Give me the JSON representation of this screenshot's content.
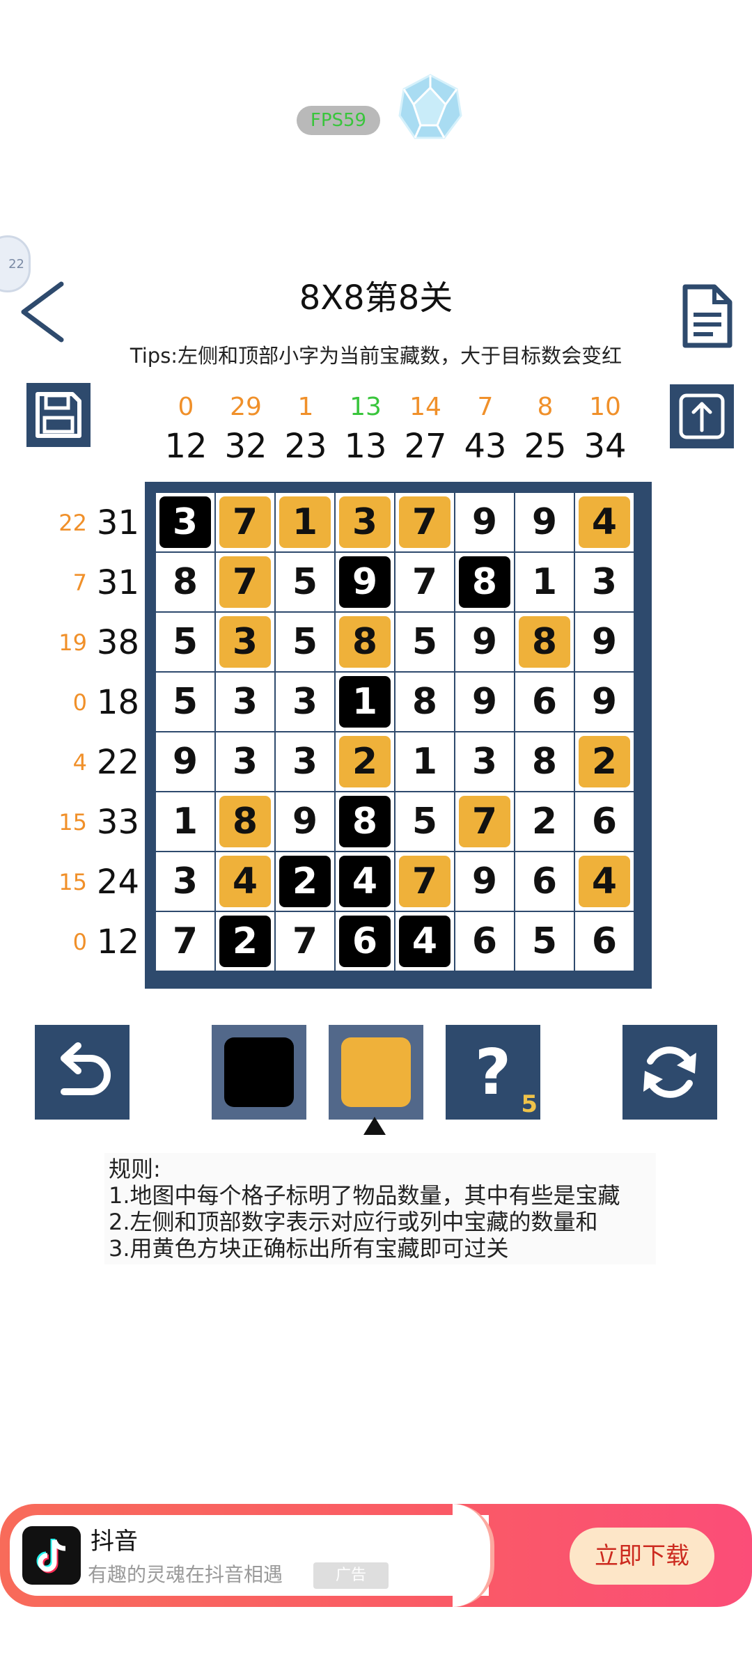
{
  "status": {
    "fps": "FPS59"
  },
  "header": {
    "title": "8X8第8关",
    "tips": "Tips:左侧和顶部小字为当前宝藏数，大于目标数会变红",
    "float_ball_text": "22"
  },
  "colors": {
    "board": "#2e4a6d",
    "treasure_yellow": "#efb13a",
    "black_mark": "#000000",
    "current_ok_green": "#39c53c",
    "current_orange": "#f0902a"
  },
  "columns": [
    {
      "current": "0",
      "target": "12",
      "state": "orange"
    },
    {
      "current": "29",
      "target": "32",
      "state": "orange"
    },
    {
      "current": "1",
      "target": "23",
      "state": "orange"
    },
    {
      "current": "13",
      "target": "13",
      "state": "green"
    },
    {
      "current": "14",
      "target": "27",
      "state": "orange"
    },
    {
      "current": "7",
      "target": "43",
      "state": "orange"
    },
    {
      "current": "8",
      "target": "25",
      "state": "orange"
    },
    {
      "current": "10",
      "target": "34",
      "state": "orange"
    }
  ],
  "rows": [
    {
      "current": "22",
      "target": "31"
    },
    {
      "current": "7",
      "target": "31"
    },
    {
      "current": "19",
      "target": "38"
    },
    {
      "current": "0",
      "target": "18"
    },
    {
      "current": "4",
      "target": "22"
    },
    {
      "current": "15",
      "target": "33"
    },
    {
      "current": "15",
      "target": "24"
    },
    {
      "current": "0",
      "target": "12"
    }
  ],
  "grid": [
    [
      {
        "v": "3",
        "m": "b"
      },
      {
        "v": "7",
        "m": "y"
      },
      {
        "v": "1",
        "m": "y"
      },
      {
        "v": "3",
        "m": "y"
      },
      {
        "v": "7",
        "m": "y"
      },
      {
        "v": "9",
        "m": ""
      },
      {
        "v": "9",
        "m": ""
      },
      {
        "v": "4",
        "m": "y"
      }
    ],
    [
      {
        "v": "8",
        "m": ""
      },
      {
        "v": "7",
        "m": "y"
      },
      {
        "v": "5",
        "m": ""
      },
      {
        "v": "9",
        "m": "b"
      },
      {
        "v": "7",
        "m": ""
      },
      {
        "v": "8",
        "m": "b"
      },
      {
        "v": "1",
        "m": ""
      },
      {
        "v": "3",
        "m": ""
      }
    ],
    [
      {
        "v": "5",
        "m": ""
      },
      {
        "v": "3",
        "m": "y"
      },
      {
        "v": "5",
        "m": ""
      },
      {
        "v": "8",
        "m": "y"
      },
      {
        "v": "5",
        "m": ""
      },
      {
        "v": "9",
        "m": ""
      },
      {
        "v": "8",
        "m": "y"
      },
      {
        "v": "9",
        "m": ""
      }
    ],
    [
      {
        "v": "5",
        "m": ""
      },
      {
        "v": "3",
        "m": ""
      },
      {
        "v": "3",
        "m": ""
      },
      {
        "v": "1",
        "m": "b"
      },
      {
        "v": "8",
        "m": ""
      },
      {
        "v": "9",
        "m": ""
      },
      {
        "v": "6",
        "m": ""
      },
      {
        "v": "9",
        "m": ""
      }
    ],
    [
      {
        "v": "9",
        "m": ""
      },
      {
        "v": "3",
        "m": ""
      },
      {
        "v": "3",
        "m": ""
      },
      {
        "v": "2",
        "m": "y"
      },
      {
        "v": "1",
        "m": ""
      },
      {
        "v": "3",
        "m": ""
      },
      {
        "v": "8",
        "m": ""
      },
      {
        "v": "2",
        "m": "y"
      }
    ],
    [
      {
        "v": "1",
        "m": ""
      },
      {
        "v": "8",
        "m": "y"
      },
      {
        "v": "9",
        "m": ""
      },
      {
        "v": "8",
        "m": "b"
      },
      {
        "v": "5",
        "m": ""
      },
      {
        "v": "7",
        "m": "y"
      },
      {
        "v": "2",
        "m": ""
      },
      {
        "v": "6",
        "m": ""
      }
    ],
    [
      {
        "v": "3",
        "m": ""
      },
      {
        "v": "4",
        "m": "y"
      },
      {
        "v": "2",
        "m": "b"
      },
      {
        "v": "4",
        "m": "b"
      },
      {
        "v": "7",
        "m": "y"
      },
      {
        "v": "9",
        "m": ""
      },
      {
        "v": "6",
        "m": ""
      },
      {
        "v": "4",
        "m": "y"
      }
    ],
    [
      {
        "v": "7",
        "m": ""
      },
      {
        "v": "2",
        "m": "b"
      },
      {
        "v": "7",
        "m": ""
      },
      {
        "v": "6",
        "m": "b"
      },
      {
        "v": "4",
        "m": "b"
      },
      {
        "v": "6",
        "m": ""
      },
      {
        "v": "5",
        "m": ""
      },
      {
        "v": "6",
        "m": ""
      }
    ]
  ],
  "tools": {
    "hint_symbol": "?",
    "hint_count": "5",
    "selected": "yellow"
  },
  "rules": {
    "heading": "规则:",
    "items": [
      "1.地图中每个格子标明了物品数量，其中有些是宝藏",
      "2.左侧和顶部数字表示对应行或列中宝藏的数量和",
      "3.用黄色方块正确标出所有宝藏即可过关"
    ]
  },
  "ad": {
    "app_name": "抖音",
    "slogan": "有趣的灵魂在抖音相遇",
    "tag": "广告",
    "cta": "立即下载"
  }
}
